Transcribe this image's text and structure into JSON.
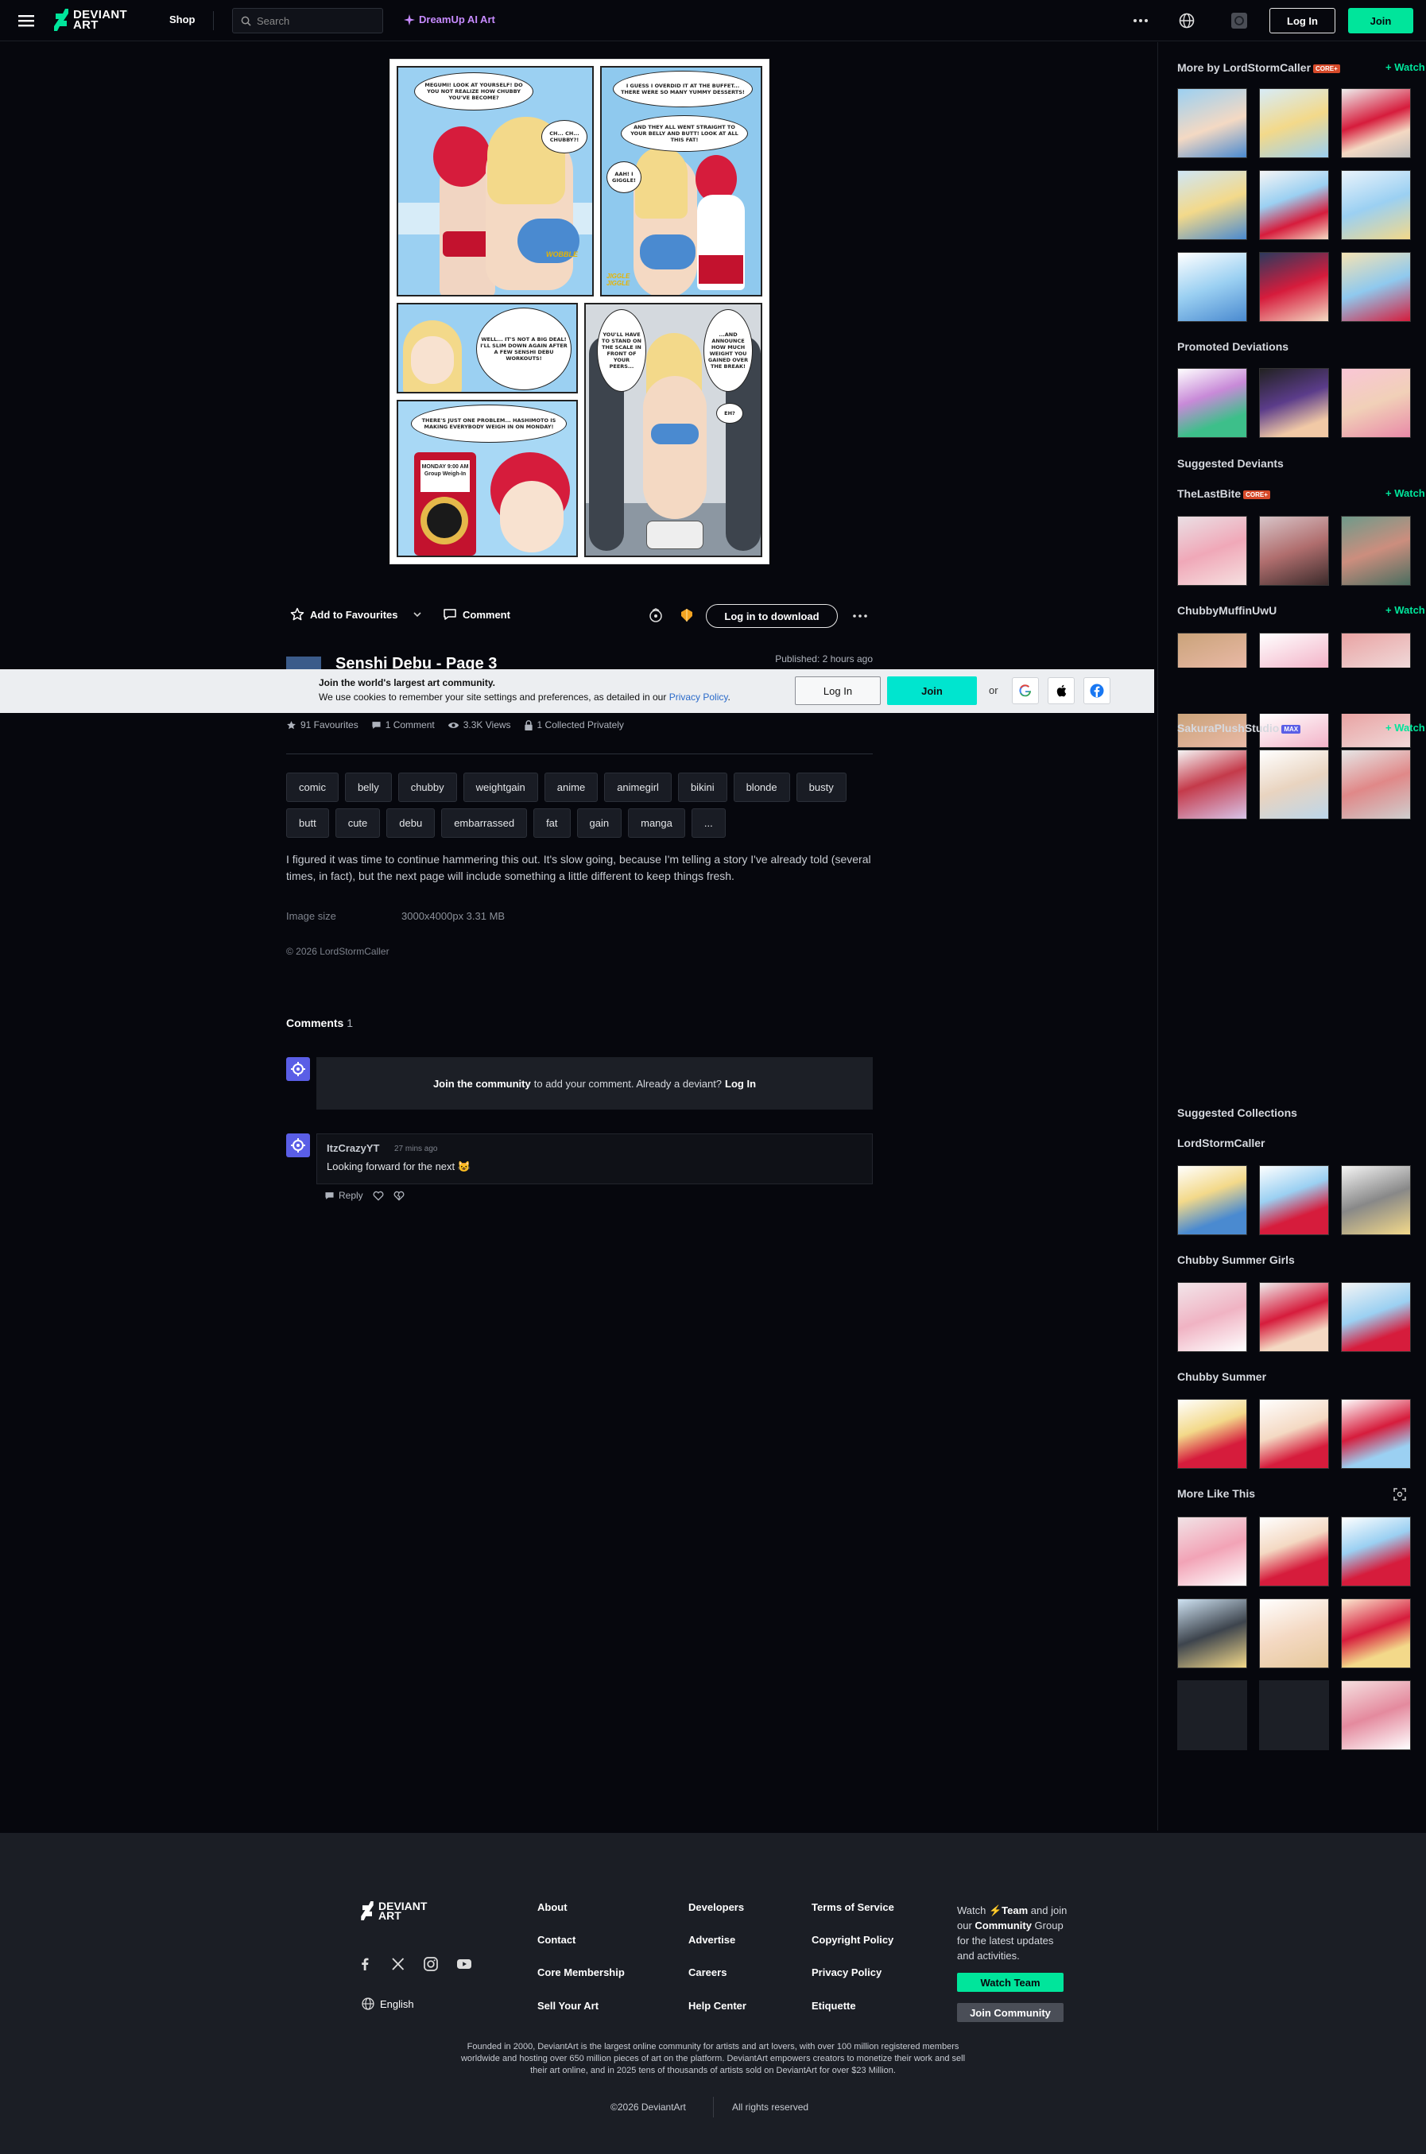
{
  "header": {
    "logo_text_line1": "DEVIANT",
    "logo_text_line2": "ART",
    "shop_label": "Shop",
    "search_placeholder": "Search",
    "dreamup_label": "DreamUp AI Art",
    "login_label": "Log In",
    "join_label": "Join"
  },
  "artwork": {
    "panel1_bubble1": "MEGUMI! LOOK AT YOURSELF! DO YOU NOT REALIZE HOW CHUBBY YOU'VE BECOME?",
    "panel1_bubble2": "CH... CH... CHUBBY?!",
    "panel1_sfx": "WOBBLE",
    "panel2_bubble1": "I GUESS I OVERDID IT AT THE BUFFET... THERE WERE SO MANY YUMMY DESSERTS!",
    "panel2_bubble2": "AND THEY ALL WENT STRAIGHT TO YOUR BELLY AND BUTT! LOOK AT ALL THIS FAT!",
    "panel2_bubble3": "AAH! I GIGGLE!",
    "panel2_sfx": "JIGGLE JIGGLE",
    "panel3_bubble": "WELL... IT'S NOT A BIG DEAL! I'LL SLIM DOWN AGAIN AFTER A FEW SENSHI DEBU WORKOUTS!",
    "panel4_bubble": "THERE'S JUST ONE PROBLEM... HASHIMOTO IS MAKING EVERYBODY WEIGH IN ON MONDAY!",
    "panel4_phone": "MONDAY 9:00 AM Group Weigh-In",
    "panel5_bubble1": "YOU'LL HAVE TO STAND ON THE SCALE IN FRONT OF YOUR PEERS...",
    "panel5_bubble2": "...AND ANNOUNCE HOW MUCH WEIGHT YOU GAINED OVER THE BREAK!",
    "panel5_bubble3": "EH?"
  },
  "actions": {
    "favourite_label": "Add to Favourites",
    "comment_label": "Comment",
    "download_label": "Log in to download"
  },
  "deviation": {
    "title": "Senshi Debu - Page 3",
    "published": "Published: 2 hours ago",
    "favourites": "91 Favourites",
    "comments": "1 Comment",
    "views": "3.3K Views",
    "collected": "1 Collected Privately",
    "tags": [
      "comic",
      "belly",
      "chubby",
      "weightgain",
      "anime",
      "animegirl",
      "bikini",
      "blonde",
      "busty",
      "butt",
      "cute",
      "debu",
      "embarrassed",
      "fat",
      "gain",
      "manga",
      "..."
    ],
    "description": "I figured it was time to continue hammering this out. It's slow going, because I'm telling a story I've already told (several times, in fact), but the next page will include something a little different to keep things fresh.",
    "image_size_label": "Image size",
    "image_size_value": "3000x4000px 3.31 MB",
    "copyright": "© 2026 LordStormCaller"
  },
  "cookie": {
    "title": "Join the world's largest art community.",
    "text": "We use cookies to remember your site settings and preferences, as detailed in our",
    "link": "Privacy Policy",
    "period": ".",
    "login_label": "Log In",
    "join_label": "Join",
    "or": "or"
  },
  "comments": {
    "heading": "Comments",
    "count": "1",
    "join_link": "Join the community",
    "join_text": "to add your comment. Already a deviant?",
    "join_login": "Log In",
    "items": [
      {
        "user": "ItzCrazyYT",
        "time": "27 mins ago",
        "text": "Looking forward for the next 😺",
        "reply_label": "Reply"
      }
    ]
  },
  "sidebar": {
    "more_by": "More by LordStormCaller",
    "core_badge": "CORE+",
    "watch_label": "Watch",
    "promoted": "Promoted Deviations",
    "suggested_deviants": "Suggested Deviants",
    "deviant1": "TheLastBite",
    "deviant2": "ChubbyMuffinUwU",
    "deviant3": "SakuraPlushStudio",
    "max_badge": "MAX",
    "suggested_collections": "Suggested Collections",
    "collection1": "LordStormCaller",
    "collection2": "Chubby Summer Girls",
    "collection3": "Chubby Summer",
    "more_like_this": "More Like This"
  },
  "footer": {
    "logo_line1": "DEVIANT",
    "logo_line2": "ART",
    "language": "English",
    "col1": [
      "About",
      "Contact",
      "Core Membership",
      "Sell Your Art"
    ],
    "col2": [
      "Developers",
      "Advertise",
      "Careers",
      "Help Center"
    ],
    "col3": [
      "Terms of Service",
      "Copyright Policy",
      "Privacy Policy",
      "Etiquette"
    ],
    "watch_text_1": "Watch",
    "watch_team": "Team",
    "watch_text_2": "and join our",
    "watch_community": "Community",
    "watch_text_3": "Group for the latest updates and activities.",
    "watch_team_btn": "Watch Team",
    "join_community_btn": "Join Community",
    "about_text": "Founded in 2000, DeviantArt is the largest online community for artists and art lovers, with over 100 million registered members worldwide and hosting over 650 million pieces of art on the platform. DeviantArt empowers creators to monetize their work and sell their art online, and in 2025 tens of thousands of artists sold on DeviantArt for over $23 Million.",
    "copyright": "©2026 DeviantArt",
    "rights": "All rights reserved"
  },
  "colors": {
    "background": "#06070d",
    "accent_green": "#00e59b",
    "join_cyan": "#00e5cf",
    "dreamup_purple": "#c78bff"
  }
}
